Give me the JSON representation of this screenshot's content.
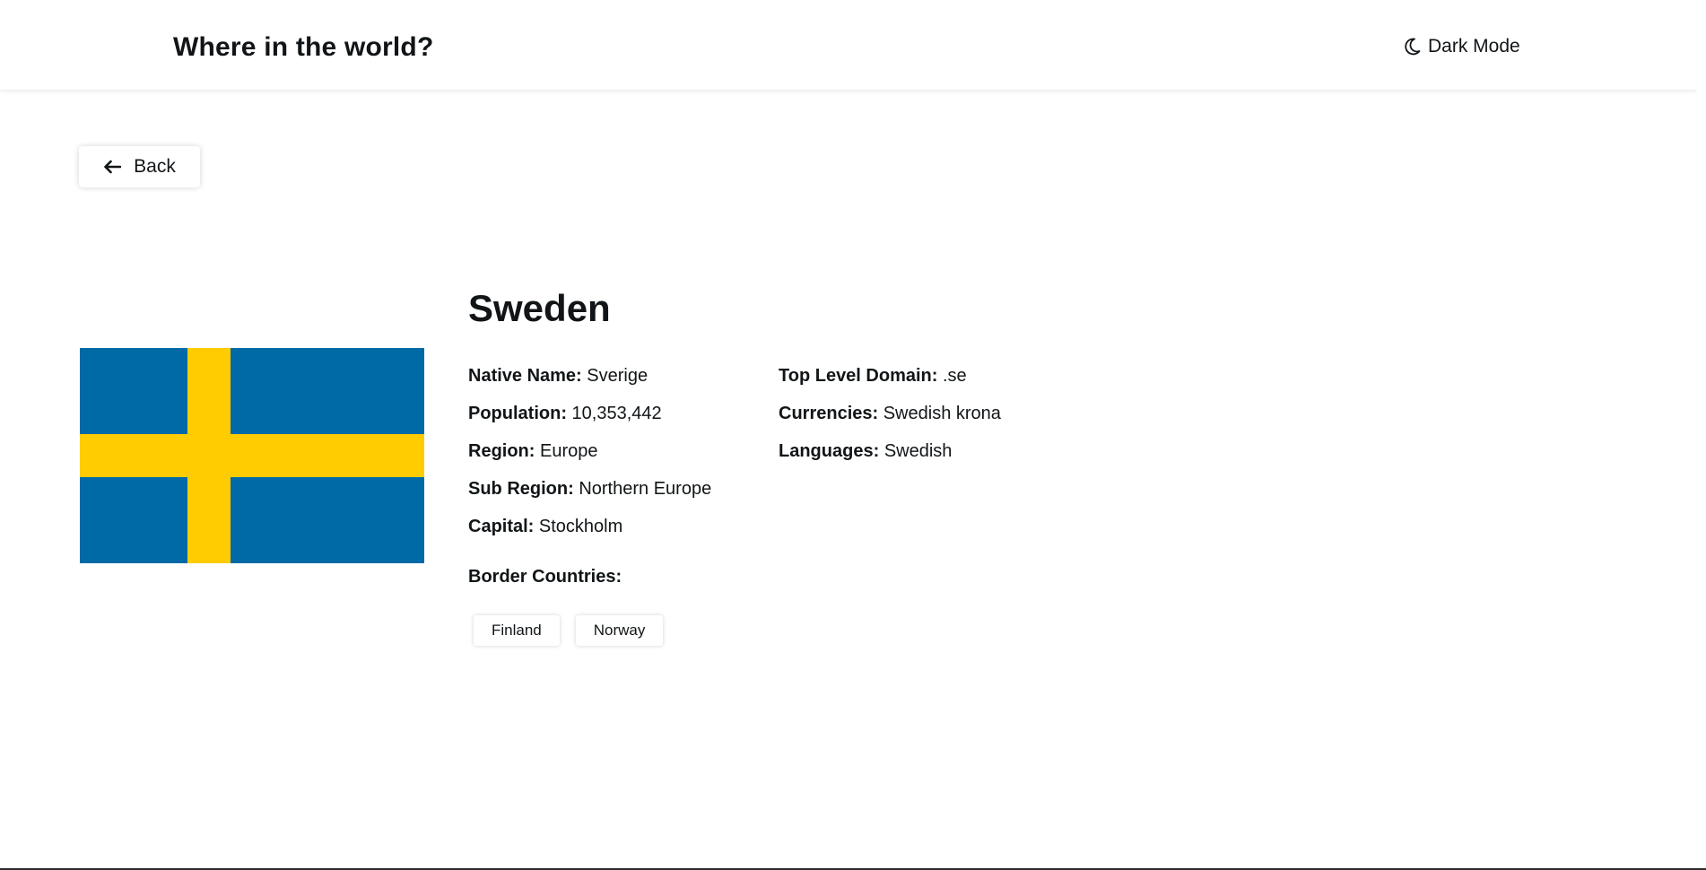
{
  "header": {
    "title": "Where in the world?",
    "theme_toggle_label": "Dark Mode",
    "theme_toggle_icon": "moon-icon"
  },
  "back_button": {
    "label": "Back",
    "icon": "arrow-left-icon"
  },
  "country": {
    "name": "Sweden",
    "flag": {
      "description_icon": "flag-sweden",
      "colors": {
        "field": "#006AA7",
        "cross": "#FECC00"
      }
    },
    "details_left": [
      {
        "label": "Native Name:",
        "value": "Sverige"
      },
      {
        "label": "Population:",
        "value": "10,353,442"
      },
      {
        "label": "Region:",
        "value": "Europe"
      },
      {
        "label": "Sub Region:",
        "value": "Northern Europe"
      },
      {
        "label": "Capital:",
        "value": "Stockholm"
      }
    ],
    "details_right": [
      {
        "label": "Top Level Domain:",
        "value": ".se"
      },
      {
        "label": "Currencies:",
        "value": "Swedish krona"
      },
      {
        "label": "Languages:",
        "value": "Swedish"
      }
    ],
    "border_countries_label": "Border Countries:",
    "border_countries": [
      "Finland",
      "Norway"
    ]
  },
  "colors": {
    "text": "#111517",
    "background": "#FFFFFF"
  }
}
